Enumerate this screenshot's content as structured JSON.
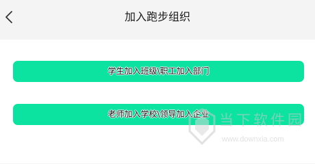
{
  "header": {
    "title": "加入跑步组织",
    "back_icon": "chevron-left-icon"
  },
  "actions": {
    "student_label": "学生加入班级\\职工加入部门",
    "teacher_label": "老师加入学校\\领导加入企业"
  },
  "watermark": {
    "brand": "当下软件园",
    "url": "www.downxia.com"
  },
  "colors": {
    "accent": "#0de3a0",
    "page_bg": "#f4f4f4",
    "panel_bg": "#ffffff"
  }
}
